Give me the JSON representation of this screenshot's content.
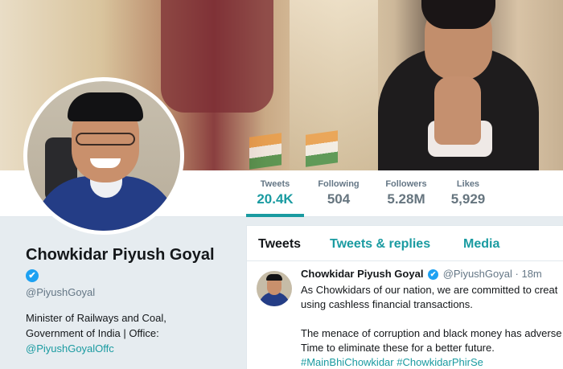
{
  "stats": [
    {
      "label": "Tweets",
      "value": "20.4K"
    },
    {
      "label": "Following",
      "value": "504"
    },
    {
      "label": "Followers",
      "value": "5.28M"
    },
    {
      "label": "Likes",
      "value": "5,929"
    }
  ],
  "profile": {
    "name": "Chowkidar Piyush Goyal",
    "verified_icon": "verified-badge-icon",
    "verified_glyph": "✔",
    "handle": "@PiyushGoyal",
    "bio_line1": "Minister of Railways and Coal,",
    "bio_line2": "Government of India | Office:",
    "bio_link": "@PiyushGoyalOffc"
  },
  "tabs": {
    "tweets": "Tweets",
    "replies": "Tweets & replies",
    "media": "Media"
  },
  "tweet": {
    "author": "Chowkidar Piyush Goyal",
    "handle": "@PiyushGoyal",
    "dot": "·",
    "time": "18m",
    "line1": "As Chowkidars of our nation, we are committed to creat",
    "line2": "using cashless financial transactions.",
    "line3": "The menace of corruption and black money has adverse",
    "line4": "Time to eliminate these for a better future.",
    "tags": "#MainBhiChowkidar #ChowkidarPhirSe"
  },
  "colors": {
    "accent": "#1a9ba1",
    "verified": "#1da1f2"
  }
}
